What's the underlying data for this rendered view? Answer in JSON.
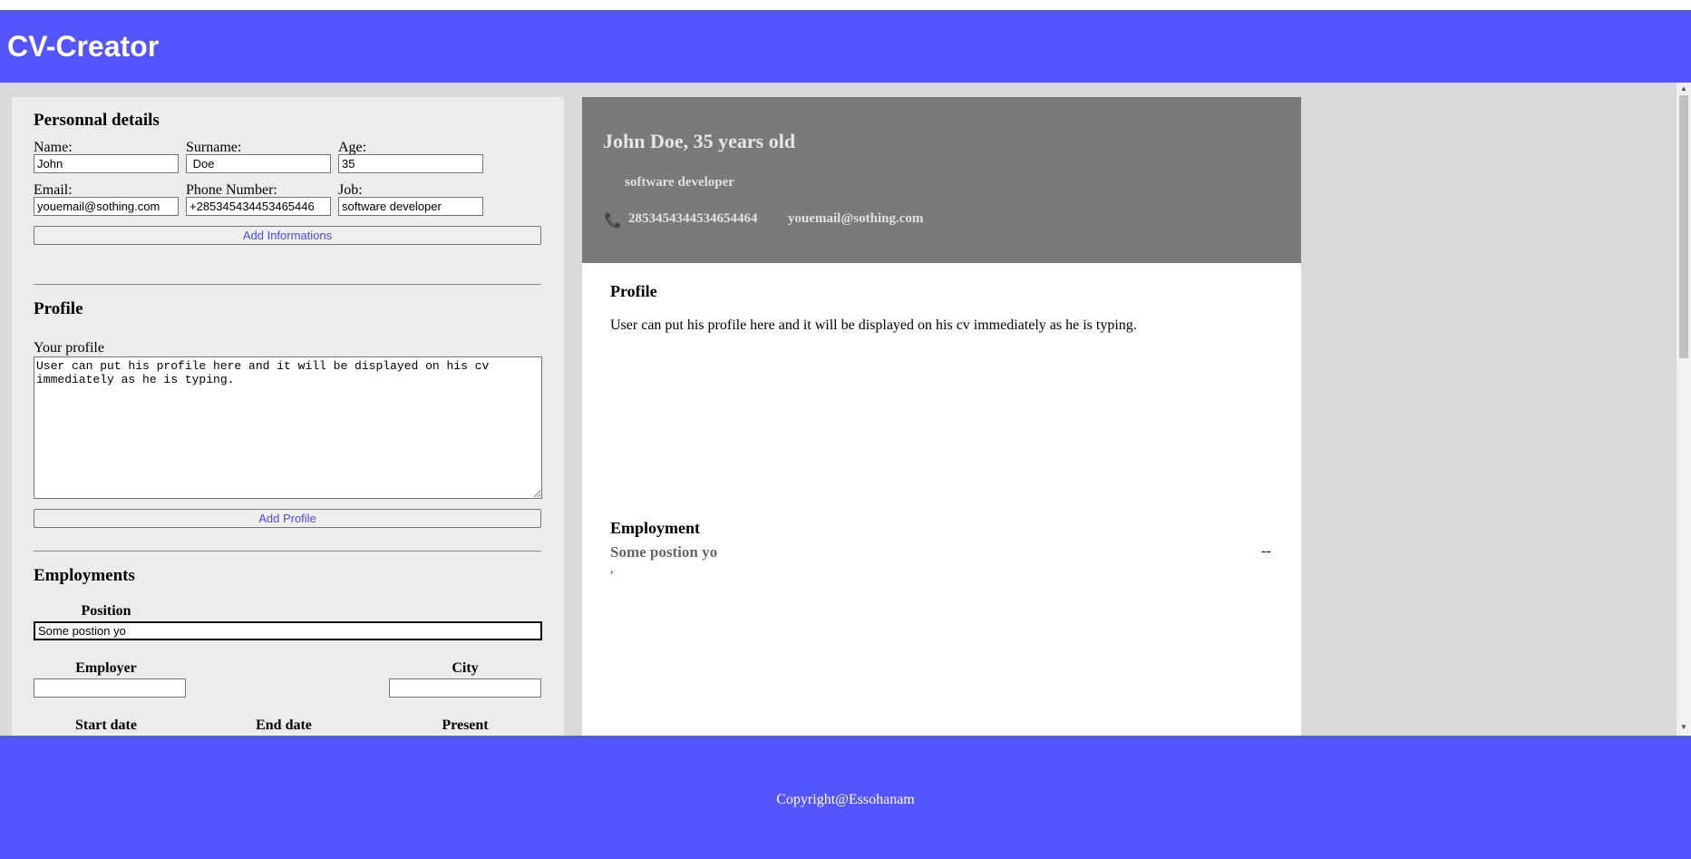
{
  "app": {
    "title": "CV-Creator"
  },
  "form": {
    "personal": {
      "title": "Personnal details",
      "labels": {
        "name": "Name:",
        "surname": "Surname:",
        "age": "Age:",
        "email": "Email:",
        "phone": "Phone Number:",
        "job": "Job:"
      },
      "values": {
        "name": "John",
        "surname": " Doe",
        "age": "35",
        "email": "youemail@sothing.com",
        "phone": "+285345434453465446",
        "job": "software developer"
      },
      "button": "Add Informations"
    },
    "profile": {
      "title": "Profile",
      "label": "Your profile",
      "value": "User can put his profile here and it will be displayed on his cv immediately as he is typing.",
      "button": "Add Profile"
    },
    "employments": {
      "title": "Employments",
      "labels": {
        "position": "Position",
        "employer": "Employer",
        "city": "City",
        "start_date": "Start date",
        "end_date": "End date",
        "present": "Present"
      },
      "values": {
        "position": "Some postion yo",
        "employer": "",
        "city": ""
      }
    }
  },
  "preview": {
    "name_line": "John Doe, 35 years old",
    "job": "software developer",
    "phone": "2853454344534654464",
    "email": "youemail@sothing.com",
    "profile_title": "Profile",
    "profile_text": "User can put his profile here and it will be displayed on his cv immediately as he is typing.",
    "employment_title": "Employment",
    "employment_position": "Some postion yo",
    "employment_dates": "--",
    "employment_place": ","
  },
  "footer": {
    "copyright": "Copyright@Essohanam"
  },
  "colors": {
    "brand": "#5555ff",
    "panel": "#ececec",
    "preview_header": "#7a7a7a",
    "page_bg": "#d9d9d9"
  },
  "icons": {
    "phone": "phone-icon"
  }
}
